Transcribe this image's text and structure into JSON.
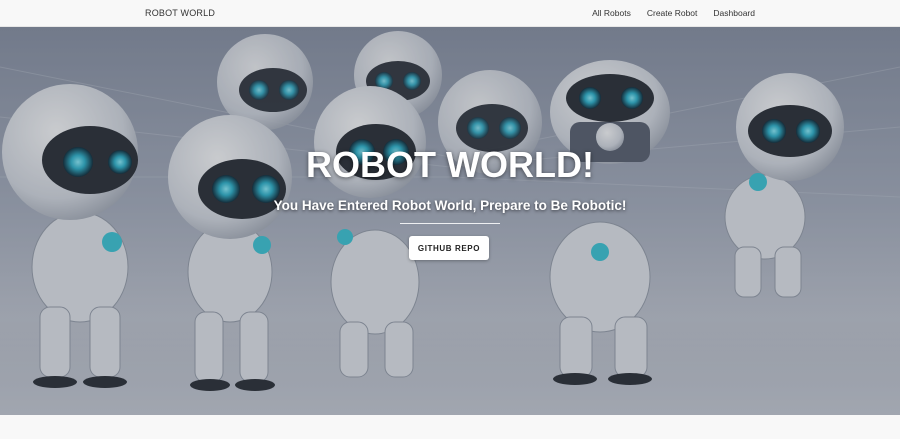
{
  "navbar": {
    "brand": "ROBOT WORLD",
    "links": [
      {
        "label": "All Robots"
      },
      {
        "label": "Create Robot"
      },
      {
        "label": "Dashboard"
      }
    ]
  },
  "hero": {
    "title": "ROBOT WORLD!",
    "subtitle": "You Have Entered Robot World, Prepare to Be Robotic!",
    "button_label": "GITHUB REPO"
  },
  "colors": {
    "accent_eye": "#3ec8d8",
    "robot_body": "#eceff3",
    "robot_dark": "#2b2f36",
    "navbar_bg": "#f8f8f8"
  }
}
